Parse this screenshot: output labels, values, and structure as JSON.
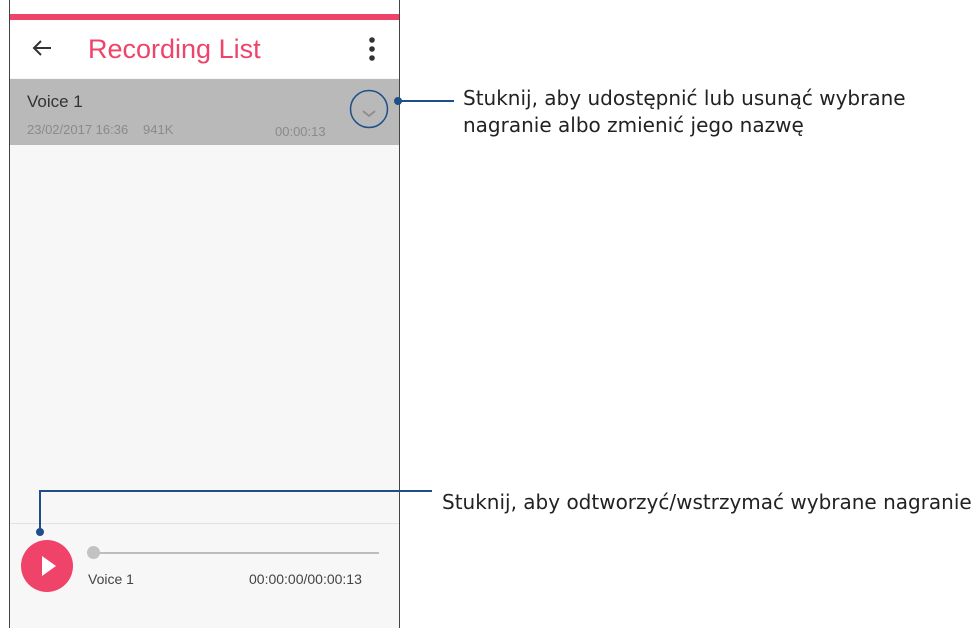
{
  "app": {
    "title": "Recording List",
    "accent_color": "#f0436a",
    "back_icon": "arrow-left-icon",
    "more_icon": "more-vertical-icon"
  },
  "recordings": [
    {
      "name": "Voice 1",
      "date": "23/02/2017 16:36",
      "size": "941K",
      "duration": "00:00:13",
      "expand_icon": "chevron-down-icon"
    }
  ],
  "player": {
    "track_name": "Voice 1",
    "time": "00:00:00/00:00:13",
    "progress": 0,
    "play_icon": "play-icon"
  },
  "callouts": {
    "options_line1": "Stuknij, aby udostępnić lub usunąć wybrane",
    "options_line2": "nagranie albo zmienić jego nazwę",
    "play": "Stuknij, aby odtworzyć/wstrzymać wybrane nagranie",
    "color": "#1f4f8a"
  }
}
